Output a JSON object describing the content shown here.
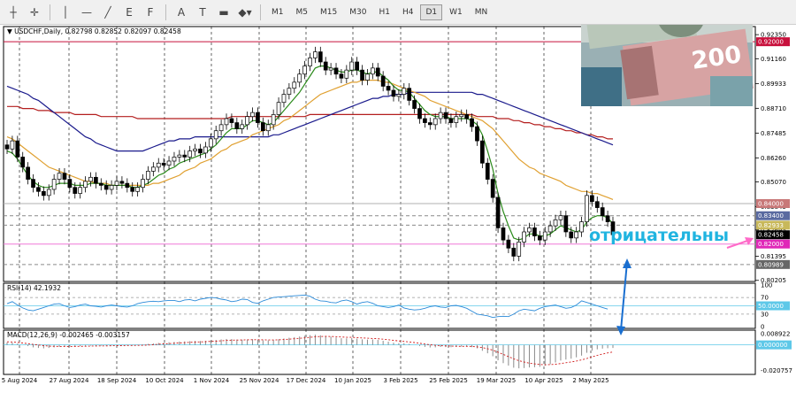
{
  "toolbar": {
    "icons": [
      "cursor-icon",
      "crosshair-icon",
      "vertical-line-icon",
      "horizontal-line-icon",
      "trendline-icon",
      "fibonacci-icon",
      "channel-icon",
      "text-icon",
      "label-icon",
      "rectangle-icon",
      "shapes-icon"
    ],
    "labels": {
      "fibonacci": "E",
      "channel": "F",
      "text": "A",
      "label": "T"
    },
    "timeframes": [
      "M1",
      "M5",
      "M15",
      "M30",
      "H1",
      "H4",
      "D1",
      "W1",
      "MN"
    ],
    "active_timeframe": "D1"
  },
  "chart_data": {
    "type": "candlestick",
    "header": "USDCHF,Daily",
    "ohlc_text": "0.82798 0.82852 0.82097 0.82458",
    "y_range": [
      0.8015,
      0.9275
    ],
    "x_labels": [
      "5 Aug 2024",
      "27 Aug 2024",
      "18 Sep 2024",
      "10 Oct 2024",
      "1 Nov 2024",
      "25 Nov 2024",
      "17 Dec 2024",
      "10 Jan 2025",
      "3 Feb 2025",
      "25 Feb 2025",
      "19 Mar 2025",
      "10 Apr 2025",
      "2 May 2025"
    ],
    "y_ticks": [
      0.9235,
      0.9116,
      0.89933,
      0.8871,
      0.87485,
      0.8626,
      0.8507,
      0.83845,
      0.82695,
      0.81395,
      0.80205
    ],
    "price_labels": [
      {
        "value": 0.92,
        "text": "0.92000",
        "color": "#c8103c"
      },
      {
        "value": 0.84,
        "text": "0.84000",
        "color": "#c87878"
      },
      {
        "value": 0.834,
        "text": "0.83400",
        "color": "#5a6aa0"
      },
      {
        "value": 0.82933,
        "text": "0.82933",
        "color": "#c8b85a"
      },
      {
        "value": 0.82458,
        "text": "0.82458",
        "color": "#000000"
      },
      {
        "value": 0.82,
        "text": "0.82000",
        "color": "#e028b8"
      },
      {
        "value": 0.80989,
        "text": "0.80989",
        "color": "#666666"
      }
    ],
    "levels": [
      0.92,
      0.84,
      0.834,
      0.82933,
      0.82,
      0.80989
    ],
    "closes": [
      0.867,
      0.871,
      0.863,
      0.858,
      0.852,
      0.848,
      0.846,
      0.844,
      0.847,
      0.852,
      0.855,
      0.852,
      0.848,
      0.845,
      0.848,
      0.851,
      0.853,
      0.85,
      0.849,
      0.847,
      0.849,
      0.851,
      0.85,
      0.848,
      0.846,
      0.848,
      0.852,
      0.856,
      0.858,
      0.86,
      0.859,
      0.861,
      0.863,
      0.864,
      0.863,
      0.866,
      0.867,
      0.865,
      0.868,
      0.872,
      0.876,
      0.879,
      0.882,
      0.88,
      0.877,
      0.879,
      0.883,
      0.885,
      0.88,
      0.876,
      0.879,
      0.884,
      0.89,
      0.894,
      0.897,
      0.9,
      0.904,
      0.908,
      0.912,
      0.915,
      0.91,
      0.906,
      0.907,
      0.904,
      0.902,
      0.906,
      0.91,
      0.906,
      0.901,
      0.904,
      0.907,
      0.903,
      0.898,
      0.896,
      0.893,
      0.894,
      0.897,
      0.891,
      0.887,
      0.882,
      0.88,
      0.879,
      0.882,
      0.885,
      0.882,
      0.88,
      0.883,
      0.884,
      0.882,
      0.878,
      0.871,
      0.86,
      0.852,
      0.843,
      0.828,
      0.822,
      0.818,
      0.814,
      0.821,
      0.826,
      0.828,
      0.824,
      0.822,
      0.826,
      0.829,
      0.832,
      0.834,
      0.826,
      0.823,
      0.826,
      0.831,
      0.844,
      0.841,
      0.838,
      0.834,
      0.831,
      0.8246
    ],
    "ma_green": [
      0.866,
      0.865,
      0.862,
      0.858,
      0.854,
      0.851,
      0.849,
      0.848,
      0.848,
      0.849,
      0.85,
      0.85,
      0.85,
      0.849,
      0.849,
      0.849,
      0.85,
      0.85,
      0.85,
      0.849,
      0.849,
      0.849,
      0.849,
      0.849,
      0.848,
      0.848,
      0.849,
      0.85,
      0.852,
      0.854,
      0.855,
      0.857,
      0.858,
      0.86,
      0.861,
      0.862,
      0.863,
      0.864,
      0.865,
      0.867,
      0.869,
      0.872,
      0.875,
      0.877,
      0.877,
      0.877,
      0.879,
      0.881,
      0.881,
      0.88,
      0.879,
      0.88,
      0.883,
      0.886,
      0.889,
      0.892,
      0.895,
      0.899,
      0.903,
      0.907,
      0.908,
      0.908,
      0.907,
      0.906,
      0.905,
      0.905,
      0.906,
      0.906,
      0.905,
      0.904,
      0.905,
      0.905,
      0.903,
      0.901,
      0.898,
      0.896,
      0.896,
      0.895,
      0.892,
      0.889,
      0.886,
      0.884,
      0.883,
      0.883,
      0.883,
      0.882,
      0.882,
      0.882,
      0.882,
      0.881,
      0.879,
      0.874,
      0.866,
      0.857,
      0.845,
      0.836,
      0.829,
      0.823,
      0.822,
      0.823,
      0.825,
      0.825,
      0.824,
      0.824,
      0.825,
      0.827,
      0.829,
      0.828,
      0.827,
      0.826,
      0.827,
      0.831,
      0.833,
      0.834,
      0.834,
      0.833,
      0.83
    ],
    "ma_orange": [
      0.873,
      0.872,
      0.87,
      0.868,
      0.866,
      0.864,
      0.862,
      0.86,
      0.858,
      0.857,
      0.856,
      0.855,
      0.854,
      0.853,
      0.852,
      0.851,
      0.851,
      0.85,
      0.85,
      0.85,
      0.849,
      0.849,
      0.849,
      0.849,
      0.849,
      0.849,
      0.849,
      0.849,
      0.85,
      0.85,
      0.851,
      0.852,
      0.853,
      0.854,
      0.856,
      0.857,
      0.858,
      0.86,
      0.861,
      0.862,
      0.864,
      0.866,
      0.867,
      0.869,
      0.87,
      0.871,
      0.872,
      0.874,
      0.875,
      0.876,
      0.877,
      0.878,
      0.879,
      0.881,
      0.882,
      0.884,
      0.886,
      0.888,
      0.89,
      0.892,
      0.894,
      0.895,
      0.896,
      0.897,
      0.898,
      0.899,
      0.9,
      0.9,
      0.901,
      0.901,
      0.901,
      0.901,
      0.9,
      0.9,
      0.899,
      0.898,
      0.897,
      0.896,
      0.895,
      0.894,
      0.893,
      0.891,
      0.89,
      0.889,
      0.888,
      0.887,
      0.886,
      0.885,
      0.884,
      0.883,
      0.882,
      0.881,
      0.879,
      0.877,
      0.874,
      0.871,
      0.868,
      0.865,
      0.862,
      0.86,
      0.858,
      0.857,
      0.855,
      0.854,
      0.853,
      0.852,
      0.851,
      0.849,
      0.848,
      0.847,
      0.846,
      0.846,
      0.845,
      0.845,
      0.844,
      0.843,
      0.842
    ],
    "ma_blue": [
      0.898,
      0.897,
      0.896,
      0.895,
      0.894,
      0.892,
      0.891,
      0.889,
      0.887,
      0.885,
      0.883,
      0.881,
      0.879,
      0.877,
      0.875,
      0.873,
      0.872,
      0.87,
      0.869,
      0.868,
      0.867,
      0.866,
      0.866,
      0.866,
      0.866,
      0.866,
      0.866,
      0.867,
      0.868,
      0.869,
      0.87,
      0.871,
      0.871,
      0.872,
      0.872,
      0.872,
      0.873,
      0.873,
      0.873,
      0.873,
      0.873,
      0.873,
      0.873,
      0.873,
      0.873,
      0.873,
      0.873,
      0.873,
      0.873,
      0.873,
      0.873,
      0.874,
      0.874,
      0.875,
      0.876,
      0.877,
      0.878,
      0.879,
      0.88,
      0.881,
      0.882,
      0.883,
      0.884,
      0.885,
      0.886,
      0.887,
      0.888,
      0.889,
      0.89,
      0.891,
      0.892,
      0.892,
      0.893,
      0.893,
      0.894,
      0.894,
      0.894,
      0.895,
      0.895,
      0.895,
      0.895,
      0.895,
      0.895,
      0.895,
      0.895,
      0.895,
      0.895,
      0.895,
      0.895,
      0.895,
      0.894,
      0.894,
      0.893,
      0.892,
      0.891,
      0.89,
      0.889,
      0.888,
      0.887,
      0.886,
      0.885,
      0.884,
      0.883,
      0.882,
      0.881,
      0.88,
      0.879,
      0.878,
      0.877,
      0.876,
      0.875,
      0.874,
      0.873,
      0.872,
      0.871,
      0.87,
      0.869
    ],
    "ma_red": [
      0.888,
      0.888,
      0.888,
      0.887,
      0.887,
      0.887,
      0.886,
      0.886,
      0.886,
      0.885,
      0.885,
      0.885,
      0.885,
      0.884,
      0.884,
      0.884,
      0.884,
      0.884,
      0.883,
      0.883,
      0.883,
      0.883,
      0.883,
      0.883,
      0.883,
      0.882,
      0.882,
      0.882,
      0.882,
      0.882,
      0.882,
      0.882,
      0.882,
      0.882,
      0.882,
      0.882,
      0.882,
      0.882,
      0.882,
      0.882,
      0.882,
      0.882,
      0.882,
      0.883,
      0.883,
      0.883,
      0.883,
      0.883,
      0.883,
      0.883,
      0.883,
      0.883,
      0.883,
      0.883,
      0.883,
      0.883,
      0.883,
      0.883,
      0.884,
      0.884,
      0.884,
      0.884,
      0.884,
      0.884,
      0.884,
      0.884,
      0.884,
      0.884,
      0.884,
      0.884,
      0.884,
      0.884,
      0.884,
      0.884,
      0.884,
      0.884,
      0.884,
      0.884,
      0.884,
      0.884,
      0.884,
      0.884,
      0.884,
      0.884,
      0.884,
      0.884,
      0.884,
      0.884,
      0.884,
      0.884,
      0.883,
      0.883,
      0.883,
      0.883,
      0.882,
      0.882,
      0.882,
      0.881,
      0.881,
      0.88,
      0.88,
      0.879,
      0.879,
      0.878,
      0.878,
      0.877,
      0.877,
      0.876,
      0.876,
      0.875,
      0.875,
      0.874,
      0.874,
      0.873,
      0.873,
      0.872,
      0.872
    ],
    "annotation": "отрицательны",
    "rsi": {
      "label": "RSI(14) 42.1932",
      "levels": [
        70,
        50,
        30
      ],
      "axis_labels": [
        "100",
        "70",
        "50.0000",
        "30",
        "0"
      ],
      "values": [
        55,
        60,
        52,
        45,
        40,
        38,
        42,
        46,
        50,
        54,
        55,
        50,
        46,
        48,
        52,
        54,
        50,
        49,
        47,
        50,
        52,
        50,
        48,
        47,
        50,
        55,
        58,
        60,
        61,
        60,
        62,
        63,
        63,
        60,
        64,
        65,
        62,
        66,
        68,
        70,
        69,
        66,
        64,
        60,
        62,
        66,
        65,
        58,
        56,
        62,
        66,
        70,
        71,
        72,
        73,
        74,
        75,
        76,
        73,
        66,
        62,
        61,
        58,
        57,
        62,
        64,
        60,
        54,
        58,
        60,
        56,
        50,
        48,
        46,
        48,
        52,
        45,
        42,
        40,
        41,
        44,
        48,
        50,
        47,
        46,
        50,
        51,
        48,
        44,
        37,
        30,
        28,
        26,
        22,
        24,
        25,
        24,
        30,
        38,
        42,
        40,
        38,
        44,
        48,
        50,
        52,
        48,
        44,
        46,
        52,
        62,
        58,
        54,
        50,
        46,
        42.19
      ]
    },
    "macd": {
      "label": "MACD(12,26,9) -0.002465 -0.003157",
      "axis_labels": [
        "0.008922",
        "0.000000",
        "-0.020757"
      ],
      "range": [
        -0.0225,
        0.0105
      ],
      "values": [
        0.002,
        0.0018,
        0.001,
        0,
        -0.001,
        -0.002,
        -0.0025,
        -0.0028,
        -0.0025,
        -0.002,
        -0.0015,
        -0.0012,
        -0.0012,
        -0.0013,
        -0.001,
        -0.0008,
        -0.0006,
        -0.0006,
        -0.0007,
        -0.0005,
        -0.0004,
        -0.0003,
        -0.0003,
        -0.0004,
        -0.0004,
        -0.0002,
        0.0002,
        0.0008,
        0.0012,
        0.0016,
        0.0018,
        0.0021,
        0.0024,
        0.0027,
        0.0028,
        0.003,
        0.0032,
        0.0031,
        0.0033,
        0.0036,
        0.004,
        0.0044,
        0.0048,
        0.0047,
        0.0043,
        0.0042,
        0.0044,
        0.0046,
        0.0042,
        0.0037,
        0.0036,
        0.0039,
        0.0045,
        0.0052,
        0.0058,
        0.0063,
        0.0068,
        0.0074,
        0.0079,
        0.0083,
        0.0078,
        0.0071,
        0.0066,
        0.006,
        0.0054,
        0.0053,
        0.0055,
        0.0051,
        0.0045,
        0.0043,
        0.0044,
        0.004,
        0.0033,
        0.0026,
        0.0018,
        0.0014,
        0.0014,
        0.0008,
        0,
        -0.0009,
        -0.0016,
        -0.0021,
        -0.002,
        -0.0017,
        -0.0018,
        -0.0019,
        -0.0016,
        -0.0014,
        -0.0014,
        -0.0018,
        -0.0028,
        -0.0048,
        -0.0068,
        -0.0092,
        -0.0125,
        -0.0148,
        -0.0168,
        -0.0185,
        -0.019,
        -0.0188,
        -0.0183,
        -0.0181,
        -0.0178,
        -0.0169,
        -0.0157,
        -0.0143,
        -0.0127,
        -0.0119,
        -0.0112,
        -0.0101,
        -0.0087,
        -0.0064,
        -0.0047,
        -0.0036,
        -0.003,
        -0.0027,
        -0.0025
      ],
      "signal": [
        0.0025,
        0.0024,
        0.002,
        0.0015,
        0.001,
        0.0004,
        -0.0001,
        -0.0006,
        -0.001,
        -0.0012,
        -0.0013,
        -0.0013,
        -0.0013,
        -0.0013,
        -0.0012,
        -0.0011,
        -0.001,
        -0.0009,
        -0.0008,
        -0.0008,
        -0.0007,
        -0.0006,
        -0.0006,
        -0.0005,
        -0.0005,
        -0.0004,
        -0.0003,
        -0.0001,
        0.0002,
        0.0005,
        0.0008,
        0.001,
        0.0013,
        0.0016,
        0.0018,
        0.002,
        0.0023,
        0.0024,
        0.0026,
        0.0028,
        0.003,
        0.0033,
        0.0036,
        0.0038,
        0.0039,
        0.004,
        0.0041,
        0.0042,
        0.0042,
        0.0041,
        0.004,
        0.004,
        0.0041,
        0.0043,
        0.0046,
        0.005,
        0.0053,
        0.0057,
        0.0061,
        0.0066,
        0.0068,
        0.0069,
        0.0068,
        0.0067,
        0.0064,
        0.0062,
        0.0061,
        0.0059,
        0.0056,
        0.0054,
        0.0052,
        0.005,
        0.0046,
        0.0042,
        0.0037,
        0.0032,
        0.0028,
        0.0024,
        0.0019,
        0.0013,
        0.0007,
        0.0001,
        -0.0003,
        -0.0006,
        -0.0008,
        -0.001,
        -0.0011,
        -0.0012,
        -0.0012,
        -0.0013,
        -0.0016,
        -0.0022,
        -0.0031,
        -0.0043,
        -0.0059,
        -0.0077,
        -0.0095,
        -0.0113,
        -0.0128,
        -0.0139,
        -0.0148,
        -0.0154,
        -0.0159,
        -0.0161,
        -0.016,
        -0.0157,
        -0.0151,
        -0.0145,
        -0.0138,
        -0.0131,
        -0.0122,
        -0.011,
        -0.0097,
        -0.0085,
        -0.0074,
        -0.0065,
        -0.0057
      ]
    }
  }
}
